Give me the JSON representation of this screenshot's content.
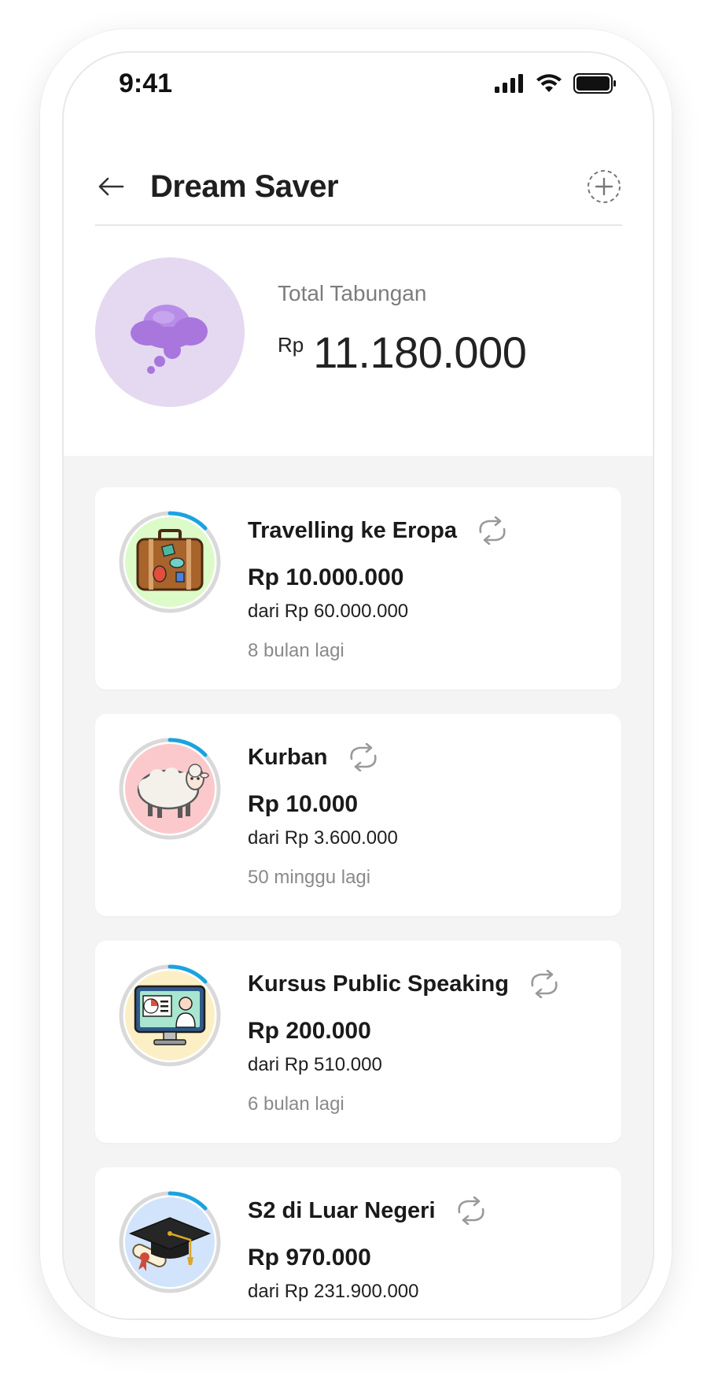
{
  "status_bar": {
    "time": "9:41"
  },
  "header": {
    "title": "Dream Saver",
    "back_icon": "arrow-left-icon",
    "add_icon": "plus-circle-dashed-icon"
  },
  "summary": {
    "label": "Total Tabungan",
    "currency": "Rp",
    "amount": "11.180.000",
    "icon": "thought-cloud-icon"
  },
  "colors": {
    "accent_blue": "#1aa3df",
    "summary_avatar_bg": "#e4d9f1",
    "cloud_purple": "#a876dd",
    "list_bg": "#f4f4f4"
  },
  "goals": [
    {
      "title": "Travelling ke Eropa",
      "saved": "Rp 10.000.000",
      "target": "dari Rp 60.000.000",
      "remaining": "8 bulan lagi",
      "icon": "suitcase-icon",
      "repeat_icon": "repeat-icon",
      "avatar_bg": "#dcfbc9"
    },
    {
      "title": "Kurban",
      "saved": "Rp 10.000",
      "target": "dari Rp 3.600.000",
      "remaining": "50 minggu lagi",
      "icon": "sheep-icon",
      "repeat_icon": "repeat-icon",
      "avatar_bg": "#fbc9cc"
    },
    {
      "title": "Kursus Public Speaking",
      "saved": "Rp 200.000",
      "target": "dari Rp 510.000",
      "remaining": "6 bulan lagi",
      "icon": "presentation-monitor-icon",
      "repeat_icon": "repeat-icon",
      "avatar_bg": "#fdefc5"
    },
    {
      "title": "S2 di Luar Negeri",
      "saved": "Rp 970.000",
      "target": "dari Rp 231.900.000",
      "remaining": "",
      "icon": "graduation-cap-icon",
      "repeat_icon": "repeat-icon",
      "avatar_bg": "#d2e4fb"
    }
  ]
}
